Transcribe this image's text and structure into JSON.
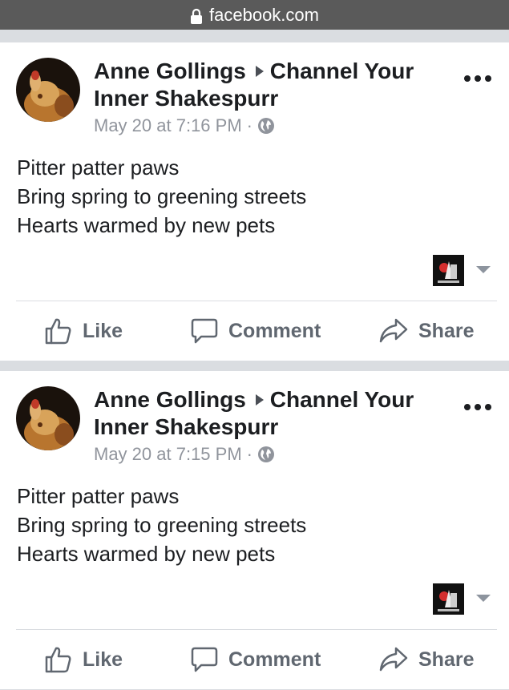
{
  "browser": {
    "url": "facebook.com",
    "lock_icon": "lock-icon"
  },
  "posts": [
    {
      "author": "Anne Gollings",
      "group": "Channel Your Inner Shakespurr",
      "timestamp": "May 20 at 7:16 PM",
      "separator": "·",
      "privacy_icon": "globe-icon",
      "lines": [
        "Pitter patter paws",
        "Bring spring to greening streets",
        "Hearts warmed by new pets"
      ],
      "actions": {
        "like": "Like",
        "comment": "Comment",
        "share": "Share"
      }
    },
    {
      "author": "Anne Gollings",
      "group": "Channel Your Inner Shakespurr",
      "timestamp": "May 20 at 7:15 PM",
      "separator": "·",
      "privacy_icon": "globe-icon",
      "lines": [
        "Pitter patter paws",
        "Bring spring to greening streets",
        "Hearts warmed by new pets"
      ],
      "actions": {
        "like": "Like",
        "comment": "Comment",
        "share": "Share"
      }
    }
  ],
  "colors": {
    "text": "#1c1e21",
    "secondary": "#90949c",
    "action": "#606770",
    "feed_background": "#dadde1",
    "url_bar": "#5a5a5a"
  }
}
